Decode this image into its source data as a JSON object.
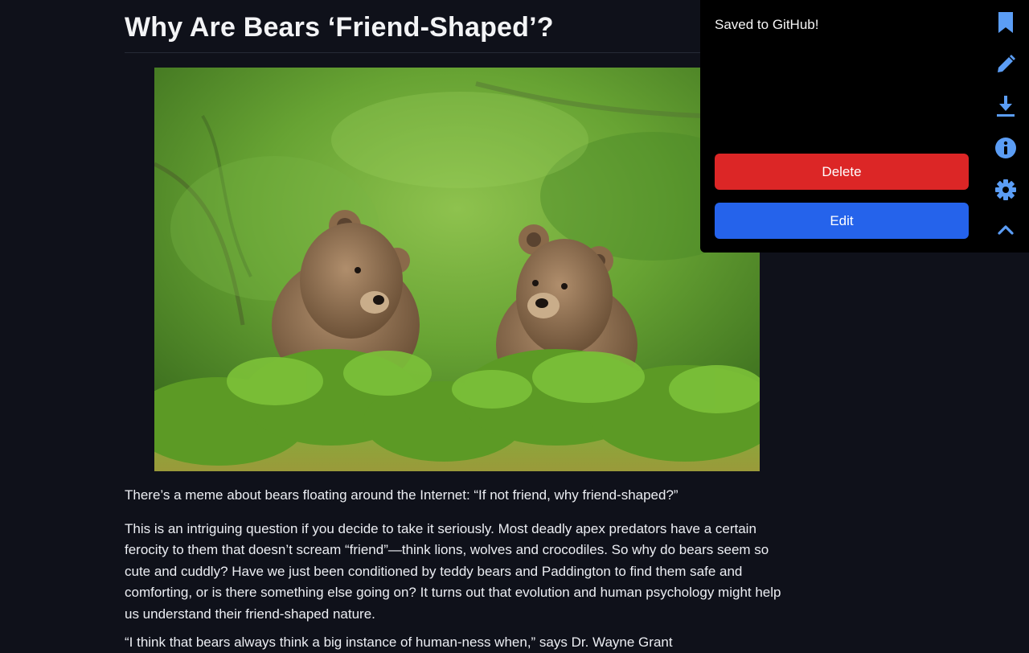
{
  "article": {
    "title": "Why Are Bears ‘Friend-Shaped’?",
    "image_alt": "Two brown bear cubs in green forest undergrowth",
    "paragraphs": [
      "There’s a meme about bears floating around the Internet: “If not friend, why friend-shaped?”",
      "This is an intriguing question if you decide to take it seriously. Most deadly apex predators have a certain ferocity to them that doesn’t scream “friend”—think lions, wolves and crocodiles. So why do bears seem so cute and cuddly? Have we just been conditioned by teddy bears and Paddington to find them safe and comforting, or is there something else going on? It turns out that evolution and human psychology might help us understand their friend-shaped nature.",
      "“I think that bears always think a big instance of human-ness when,” says Dr. Wayne Grant"
    ]
  },
  "popup": {
    "toast": "Saved to GitHub!",
    "delete_label": "Delete",
    "edit_label": "Edit",
    "icons": [
      "bookmark-icon",
      "pencil-icon",
      "download-icon",
      "info-icon",
      "gear-icon",
      "chevron-up-icon"
    ],
    "accent": "#5b9df5",
    "delete_color": "#dc2626",
    "edit_color": "#2563eb"
  }
}
